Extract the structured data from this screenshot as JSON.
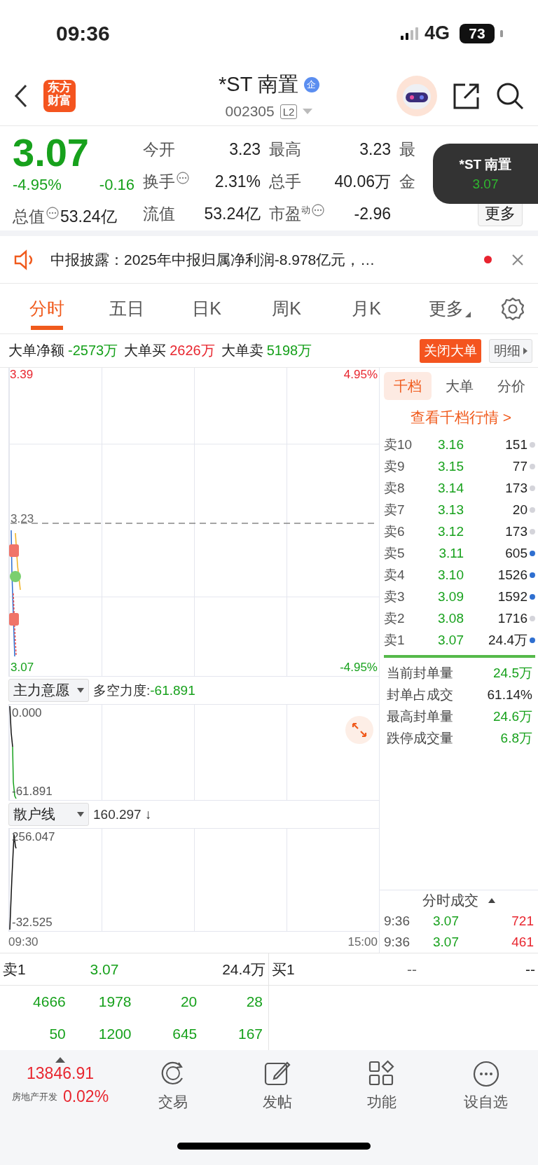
{
  "status_bar": {
    "time": "09:36",
    "network": "4G",
    "battery": "73"
  },
  "header": {
    "logo": "东方财富",
    "title": "*ST 南置",
    "title_badge": "企",
    "code": "002305",
    "level_badge": "L2"
  },
  "quote": {
    "price": "3.07",
    "change_pct": "-4.95%",
    "change": "-0.16",
    "color": "#17a11c",
    "stats": [
      {
        "label": "今开",
        "value": "3.23",
        "info": false
      },
      {
        "label": "最高",
        "value": "3.23",
        "info": false
      },
      {
        "label": "最",
        "info": false
      },
      {
        "label": "换手",
        "value": "2.31%",
        "info": true
      },
      {
        "label": "总手",
        "value": "40.06万",
        "info": false
      },
      {
        "label": "金",
        "info": false
      },
      {
        "label": "总值",
        "value": "53.24亿",
        "info": true
      },
      {
        "label": "流值",
        "value": "53.24亿",
        "info": false
      },
      {
        "label": "市盈$^{动}$",
        "value": "-2.96",
        "info": true
      }
    ],
    "more_button": "更多"
  },
  "floating_quote": {
    "name": "*ST 南置",
    "price": "3.07"
  },
  "notice": {
    "text": "中报披露：2025年中报归属净利润-8.978亿元，…",
    "unread": true
  },
  "tabs": [
    {
      "label": "分时",
      "selected": true,
      "dropdown": false
    },
    {
      "label": "五日",
      "selected": false,
      "dropdown": false
    },
    {
      "label": "日K",
      "selected": false,
      "dropdown": false
    },
    {
      "label": "周K",
      "selected": false,
      "dropdown": false
    },
    {
      "label": "月K",
      "selected": false,
      "dropdown": false
    },
    {
      "label": "更多",
      "selected": false,
      "dropdown": true
    }
  ],
  "big_orders": {
    "items": [
      {
        "label": "大单净额",
        "value": "-2573万",
        "color": "#17a11c"
      },
      {
        "label": "大单买",
        "value": "2626万",
        "color": "#e8262f"
      },
      {
        "label": "大单卖",
        "value": "5198万",
        "color": "#17a11c"
      }
    ],
    "close_button": "关闭大单",
    "detail_button": "明细"
  },
  "price_chart": {
    "high": "3.39",
    "high_pct": "4.95%",
    "reference": "3.23",
    "low": "3.07",
    "low_pct": "-4.95%"
  },
  "indicators": [
    {
      "name": "主力意愿",
      "reading_label": "多空力度:",
      "reading": "-61.891",
      "max": "0.000",
      "min": "-61.891"
    },
    {
      "name": "散户线",
      "reading_label": "160.297 ↓",
      "max": "256.047",
      "min": "-32.525"
    }
  ],
  "time_axis": [
    "09:30",
    "15:00"
  ],
  "depth": {
    "tabs": [
      {
        "label": "千档",
        "selected": true
      },
      {
        "label": "大单",
        "selected": false
      },
      {
        "label": "分价",
        "selected": false
      }
    ],
    "link": "查看千档行情 >",
    "asks": [
      {
        "label": "卖10",
        "price": "3.16",
        "volume": "151",
        "color": "#d4d4da"
      },
      {
        "label": "卖9",
        "price": "3.15",
        "volume": "77",
        "color": "#d4d4da"
      },
      {
        "label": "卖8",
        "price": "3.14",
        "volume": "173",
        "color": "#d4d4da"
      },
      {
        "label": "卖7",
        "price": "3.13",
        "volume": "20",
        "color": "#d4d4da"
      },
      {
        "label": "卖6",
        "price": "3.12",
        "volume": "173",
        "color": "#d4d4da"
      },
      {
        "label": "卖5",
        "price": "3.11",
        "volume": "605",
        "color": "#2f6fd0"
      },
      {
        "label": "卖4",
        "price": "3.10",
        "volume": "1526",
        "color": "#2f6fd0"
      },
      {
        "label": "卖3",
        "price": "3.09",
        "volume": "1592",
        "color": "#2f6fd0"
      },
      {
        "label": "卖2",
        "price": "3.08",
        "volume": "1716",
        "color": "#d4d4da"
      },
      {
        "label": "卖1",
        "price": "3.07",
        "volume": "24.4万",
        "color": "#2f6fd0"
      }
    ],
    "stats": [
      {
        "label": "当前封单量",
        "value": "24.5万",
        "color": "#17a11c"
      },
      {
        "label": "封单占成交",
        "value": "61.14%",
        "color": "#222222"
      },
      {
        "label": "最高封单量",
        "value": "24.6万",
        "color": "#17a11c"
      },
      {
        "label": "跌停成交量",
        "value": "6.8万",
        "color": "#17a11c"
      }
    ],
    "trades_title": "分时成交",
    "trades": [
      {
        "time": "9:36",
        "price": "3.07",
        "volume": "721"
      },
      {
        "time": "9:36",
        "price": "3.07",
        "volume": "461"
      }
    ]
  },
  "order_book": {
    "sell": {
      "label": "卖1",
      "price": "3.07",
      "volume": "24.4万"
    },
    "buy": {
      "label": "买1",
      "price": "--",
      "volume": "--"
    },
    "queue": [
      [
        "4666",
        "1978",
        "20",
        "28"
      ],
      [
        "50",
        "1200",
        "645",
        "167"
      ]
    ]
  },
  "bottom_bar": {
    "index": "13846.91",
    "sector": "房地产开发",
    "sector_change": "0.02%",
    "color": "#e8262f",
    "items": [
      {
        "kind": "trade",
        "label": "交易"
      },
      {
        "kind": "post",
        "label": "发帖"
      },
      {
        "kind": "functions",
        "label": "功能"
      },
      {
        "kind": "watchlist",
        "label": "设自选"
      }
    ]
  }
}
